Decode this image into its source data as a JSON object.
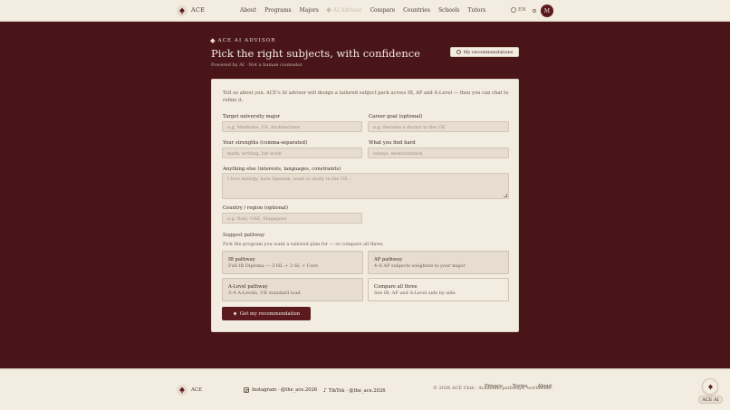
{
  "nav": {
    "brand": "ACE",
    "links": [
      "About",
      "Programs",
      "Majors",
      "AI Advisor",
      "Compare",
      "Countries",
      "Schools",
      "Tutors"
    ],
    "lang": "EN",
    "avatar_initial": "M"
  },
  "header": {
    "eyebrow": "ACE AI ADVISOR",
    "title": "Pick the right subjects, with confidence",
    "powered": "Powered by AI · Not a human counselor",
    "my_recs": "My recommendations"
  },
  "form": {
    "intro": "Tell us about you. ACE's AI advisor will design a tailored subject pack across IB, AP and A-Level — then you can chat to refine it.",
    "major": {
      "label": "Target university major",
      "placeholder": "e.g. Medicine, CS, Architecture"
    },
    "career": {
      "label": "Career goal (optional)",
      "placeholder": "e.g. Become a doctor in the UK"
    },
    "strengths": {
      "label": "Your strengths (comma-separated)",
      "placeholder": "math, writing, lab work"
    },
    "hard": {
      "label": "What you find hard",
      "placeholder": "essays, memorization"
    },
    "anything": {
      "label": "Anything else (interests, languages, constraints)",
      "placeholder": "I love biology, hate Spanish, want to study in the US..."
    },
    "country": {
      "label": "Country / region (optional)",
      "placeholder": "e.g. Italy, UAE, Singapore"
    },
    "pathway": {
      "label": "Suggest pathway",
      "sub": "Pick the program you want a tailored plan for — or compare all three.",
      "options": [
        {
          "title": "IB pathway",
          "desc": "Full IB Diploma — 3 HL + 3 SL + Core"
        },
        {
          "title": "AP pathway",
          "desc": "4–6 AP subjects weighted to your major"
        },
        {
          "title": "A-Level pathway",
          "desc": "3–4 A-Levels, UK standard load"
        },
        {
          "title": "Compare all three",
          "desc": "See IB, AP and A-Level side by side"
        }
      ]
    },
    "submit": "Get my recommendation"
  },
  "footer": {
    "brand": "ACE",
    "instagram": "Instagram · @the_ace.2026",
    "tiktok": "TikTok · @the_ace.2026",
    "links": [
      "Privacy",
      "Terms",
      "About"
    ],
    "copyright": "© 2026 ACE Club · Academic pathways, worldwide.",
    "chat_label": "ACE AI"
  },
  "colors": {
    "background": "#4a1519",
    "surface": "#f3ece1",
    "accent": "#5b1a1d"
  },
  "icons": [
    "spade-logo-icon",
    "diamond-icon",
    "globe-icon",
    "theme-toggle-icon",
    "clock-icon",
    "instagram-icon",
    "tiktok-icon",
    "spade-icon"
  ]
}
